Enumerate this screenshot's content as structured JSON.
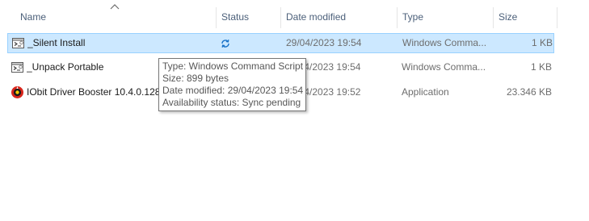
{
  "columns": {
    "name": "Name",
    "status": "Status",
    "date_modified": "Date modified",
    "type": "Type",
    "size": "Size"
  },
  "sort": {
    "column": "name",
    "direction": "ascending",
    "icon": "chevron-up-icon"
  },
  "files": [
    {
      "name": "_Silent Install",
      "status_icon": "sync-pending-icon",
      "date_modified": "29/04/2023 19:54",
      "type": "Windows Comma...",
      "size": "1 KB",
      "icon": "script-file-icon",
      "selected": true
    },
    {
      "name": "_Unpack Portable",
      "status_icon": "",
      "date_modified": "29/04/2023 19:54",
      "type": "Windows Comma...",
      "size": "1 KB",
      "icon": "script-file-icon",
      "selected": false
    },
    {
      "name": "IObit Driver Booster 10.4.0.128",
      "status_icon": "",
      "date_modified": "29/04/2023 19:52",
      "type": "Application",
      "size": "23.346 KB",
      "icon": "driver-booster-app-icon",
      "selected": false
    }
  ],
  "tooltip": {
    "type_line": "Type: Windows Command Script",
    "size_line": "Size: 899 bytes",
    "date_line": "Date modified: 29/04/2023 19:54",
    "availability_line": "Availability status: Sync pending"
  },
  "colors": {
    "selection_fill": "#cce8ff",
    "selection_border": "#99d1ff",
    "header_text": "#4c607a",
    "sync_icon": "#1a73c8"
  }
}
